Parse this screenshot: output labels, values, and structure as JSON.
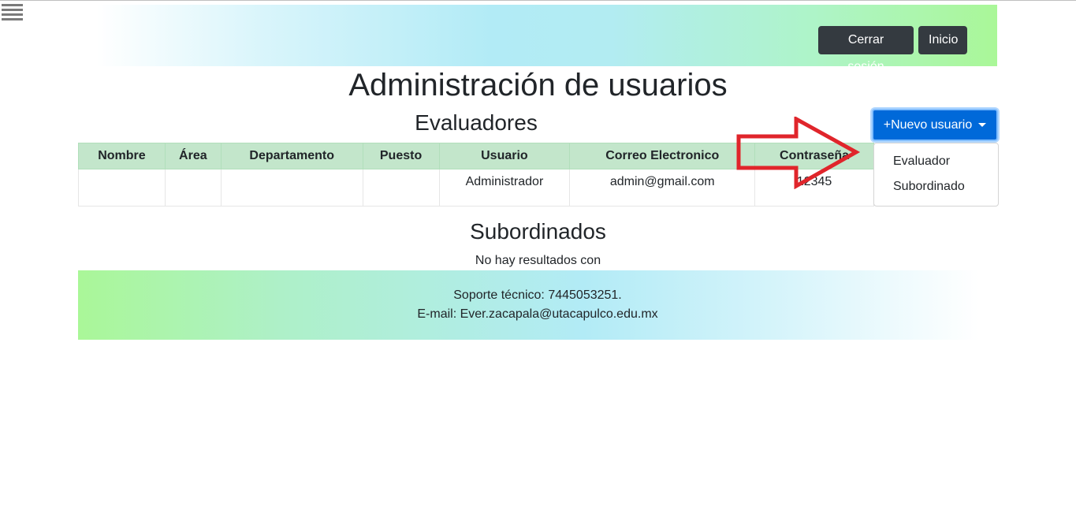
{
  "header": {
    "logout_label": "Cerrar sesión",
    "home_label": "Inicio"
  },
  "page_title": "Administración de usuarios",
  "evaluators": {
    "title": "Evaluadores",
    "columns": [
      "Nombre",
      "Área",
      "Departamento",
      "Puesto",
      "Usuario",
      "Correo Electronico",
      "Contraseña"
    ],
    "rows": [
      [
        "",
        "",
        "",
        "",
        "Administrador",
        "admin@gmail.com",
        "12345"
      ]
    ]
  },
  "new_user": {
    "label": "+Nuevo usuario",
    "options": [
      "Evaluador",
      "Subordinado"
    ]
  },
  "subordinates": {
    "title": "Subordinados",
    "empty_text": "No hay resultados con"
  },
  "footer": {
    "support": "Soporte técnico: 7445053251.",
    "email": "E-mail: Ever.zacapala@utacapulco.edu.mx"
  },
  "colors": {
    "table_header": "#c3e6cb",
    "primary_button": "#0069d9",
    "dark_button": "#343a40",
    "annotation_arrow": "#e0252b"
  },
  "icons": {
    "menu": "hamburger-menu-icon",
    "dropdown": "caret-down-icon",
    "annotation": "red-arrow"
  }
}
